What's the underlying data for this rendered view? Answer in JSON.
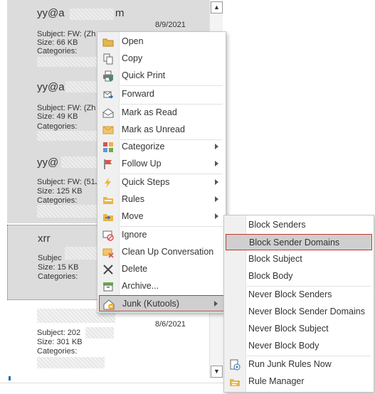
{
  "messages": [
    {
      "sender": "yy@a",
      "sender_tail": "m",
      "date": "8/9/2021",
      "subject": "Subject: FW: (Zh",
      "size": "Size: 66 KB",
      "categories": "Categories:"
    },
    {
      "sender": "yy@a",
      "sender_tail": "",
      "date": "",
      "subject": "Subject: FW: (Zh",
      "size": "Size: 49 KB",
      "categories": "Categories:"
    },
    {
      "sender": "yy@",
      "sender_tail": "",
      "date": "",
      "subject": "Subject: FW: (51J",
      "size": "Size: 125 KB",
      "categories": "Categories:"
    },
    {
      "sender": "xrr",
      "sender_tail": "",
      "date": "",
      "subject": "Subjec",
      "size": "Size: 15 KB",
      "categories": "Categories:"
    },
    {
      "sender": "",
      "sender_tail": "",
      "date": "8/6/2021",
      "subject": "Subject: 202",
      "size": "Size: 301 KB",
      "categories": "Categories:"
    }
  ],
  "context_menu": {
    "items": [
      {
        "label": "Open",
        "icon": "folder-open-icon"
      },
      {
        "label": "Copy",
        "icon": "copy-icon"
      },
      {
        "label": "Quick Print",
        "icon": "printer-icon"
      },
      {
        "label": "Forward",
        "icon": "forward-icon"
      },
      {
        "label": "Mark as Read",
        "icon": "envelope-open-icon"
      },
      {
        "label": "Mark as Unread",
        "icon": "envelope-closed-icon"
      },
      {
        "label": "Categorize",
        "icon": "categorize-icon"
      },
      {
        "label": "Follow Up",
        "icon": "flag-icon"
      },
      {
        "label": "Quick Steps",
        "icon": "lightning-icon"
      },
      {
        "label": "Rules",
        "icon": "rules-icon"
      },
      {
        "label": "Move",
        "icon": "move-folder-icon"
      },
      {
        "label": "Ignore",
        "icon": "ignore-icon"
      },
      {
        "label": "Clean Up Conversation",
        "icon": "cleanup-icon"
      },
      {
        "label": "Delete",
        "icon": "delete-x-icon"
      },
      {
        "label": "Archive...",
        "icon": "archive-box-icon"
      },
      {
        "label": "Junk (Kutools)",
        "icon": "junk-icon"
      }
    ]
  },
  "submenu": {
    "items": [
      {
        "label": "Block Senders"
      },
      {
        "label": "Block Sender Domains"
      },
      {
        "label": "Block Subject"
      },
      {
        "label": "Block Body"
      },
      {
        "label": "Never Block Senders"
      },
      {
        "label": "Never Block Sender Domains"
      },
      {
        "label": "Never Block Subject"
      },
      {
        "label": "Never Block Body"
      },
      {
        "label": "Run Junk Rules Now",
        "icon": "run-rules-icon"
      },
      {
        "label": "Rule Manager",
        "icon": "rule-manager-icon"
      }
    ]
  },
  "colors": {
    "highlight_border": "#c0392b",
    "highlight_bg": "#cfcfcf",
    "selected_bg": "#dcdcdc"
  }
}
